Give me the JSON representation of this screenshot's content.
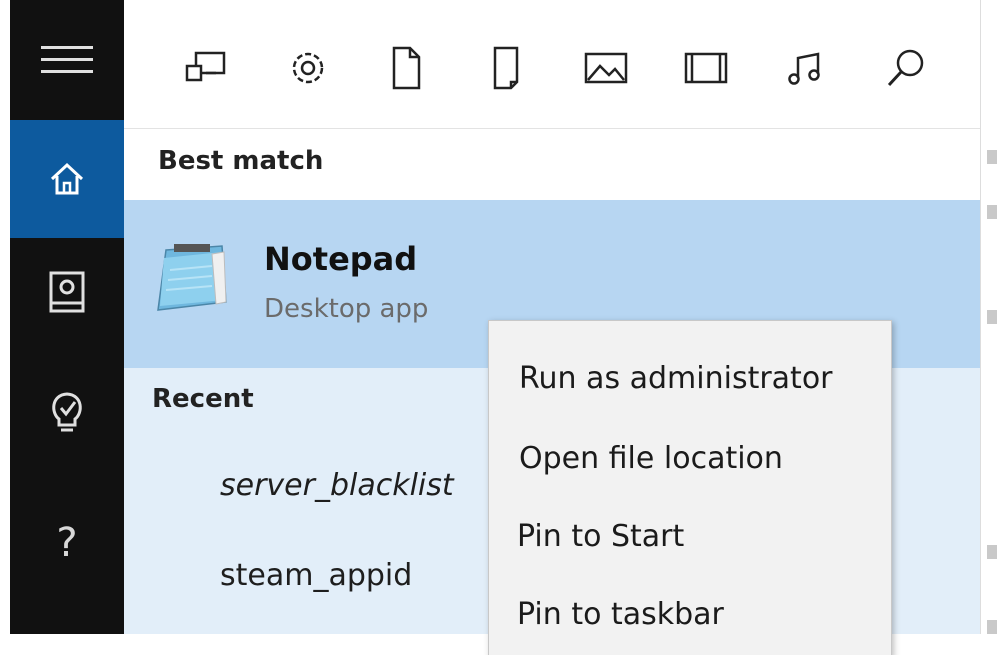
{
  "rail": {
    "help_glyph": "?",
    "icons": [
      "hamburger-menu-icon",
      "home-icon",
      "notebook-icon",
      "lightbulb-icon",
      "help-icon"
    ]
  },
  "filters": {
    "icons": [
      "apps-icon",
      "settings-icon",
      "documents-icon",
      "folders-icon",
      "photos-icon",
      "videos-icon",
      "music-icon",
      "web-search-icon"
    ]
  },
  "best_match": {
    "header": "Best match",
    "title": "Notepad",
    "subtitle": "Desktop app"
  },
  "recent": {
    "header": "Recent",
    "items": [
      "server_blacklist",
      "steam_appid"
    ]
  },
  "context_menu": {
    "items": [
      "Run as administrator",
      "Open file location",
      "Pin to Start",
      "Pin to taskbar"
    ]
  },
  "colors": {
    "rail_bg": "#111111",
    "home_selected": "#0d5a9e",
    "result_highlight": "#b7d6f2",
    "recent_bg": "#e2eef9",
    "menu_bg": "#f2f2f2"
  }
}
